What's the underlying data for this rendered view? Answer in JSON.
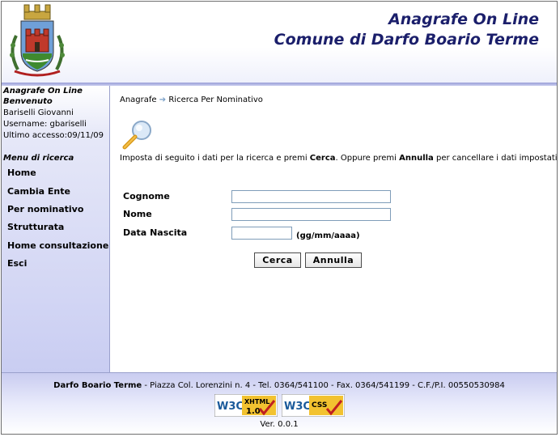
{
  "header": {
    "title_line1": "Anagrafe On Line",
    "title_line2": "Comune di Darfo Boario Terme"
  },
  "sidebar": {
    "app_name": "Anagrafe On Line",
    "welcome": "Benvenuto",
    "user_name": "Bariselli Giovanni",
    "username_line": "Username: gbariselli",
    "last_access": "Ultimo accesso:09/11/09",
    "menu_title": "Menu di ricerca",
    "items": [
      {
        "label": "Home"
      },
      {
        "label": "Cambia Ente"
      },
      {
        "label": "Per nominativo"
      },
      {
        "label": "Strutturata"
      },
      {
        "label": "Home consultazione"
      },
      {
        "label": "Esci"
      }
    ]
  },
  "breadcrumb": {
    "root": "Anagrafe",
    "separator": "➔",
    "current": "Ricerca Per Nominativo"
  },
  "instruction": {
    "part1": "Imposta di seguito i dati per la ricerca e premi ",
    "bold1": "Cerca",
    "part2": ".  Oppure premi ",
    "bold2": "Annulla",
    "part3": " per cancellare i dati impostati."
  },
  "form": {
    "cognome_label": "Cognome",
    "cognome_value": "",
    "nome_label": "Nome",
    "nome_value": "",
    "data_label": "Data Nascita",
    "data_value": "",
    "date_hint": "(gg/mm/aaaa)",
    "search_button": "Cerca",
    "cancel_button": "Annulla"
  },
  "footer": {
    "org_name": "Darfo Boario Terme",
    "address": " - Piazza Col. Lorenzini n. 4 - Tel. 0364/541100 - Fax. 0364/541199 - C.F./P.I. 00550530984",
    "badge_xhtml_top": "XHTML",
    "badge_xhtml_version": "1.0",
    "badge_w3c": "W3C",
    "badge_css": "CSS",
    "version": "Ver. 0.0.1"
  },
  "icons": {
    "crest": "municipal-crest-icon",
    "search": "magnifier-icon",
    "arrow": "breadcrumb-arrow-icon"
  },
  "colors": {
    "title": "#1b1f6b",
    "sidebar_bottom": "#c9cdf2",
    "accent_arrow": "#7aa0c8"
  }
}
